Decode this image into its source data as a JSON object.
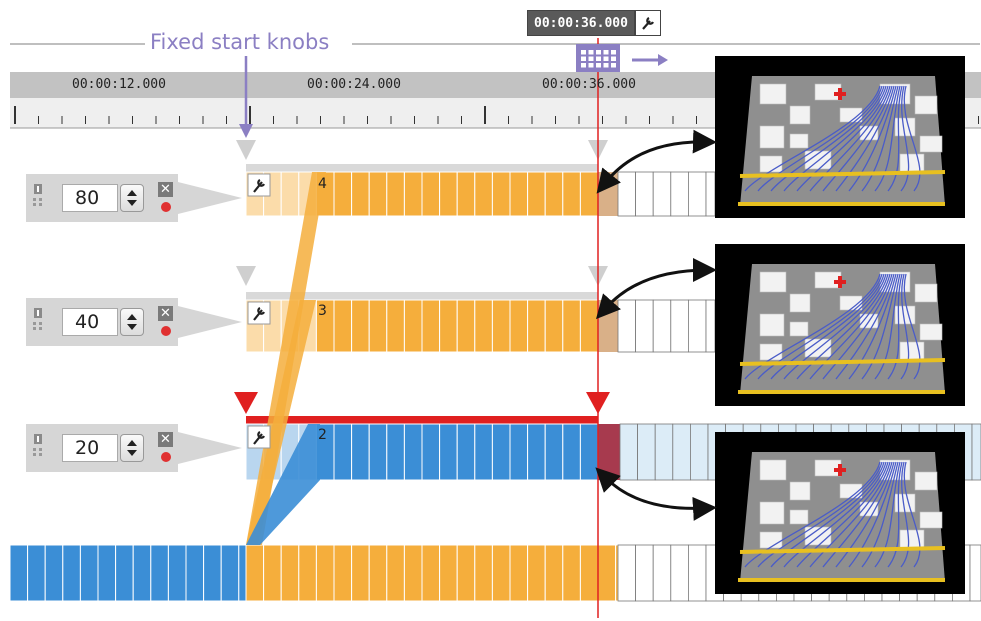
{
  "annotation": {
    "fixed_start_label": "Fixed start knobs"
  },
  "playhead": {
    "time": "00:00:36.000"
  },
  "ruler": {
    "labels": [
      "00:00:12.000",
      "00:00:24.000",
      "00:00:36.000"
    ]
  },
  "tracks": [
    {
      "value": "80",
      "index": "4",
      "color": "#f5ae3c"
    },
    {
      "value": "40",
      "index": "3",
      "color": "#f5ae3c"
    },
    {
      "value": "20",
      "index": "2",
      "color": "#3b8ed6"
    }
  ],
  "colors": {
    "accent": "#8b7fc3",
    "playhead": "#e02020",
    "orange": "#f5ae3c",
    "blue": "#3b8ed6"
  },
  "icons": {
    "wrench": "wrench-icon",
    "calendar": "calendar-icon",
    "arrow": "arrow-right-icon",
    "pin": "pin-icon",
    "close": "close-icon",
    "record": "record-icon"
  }
}
